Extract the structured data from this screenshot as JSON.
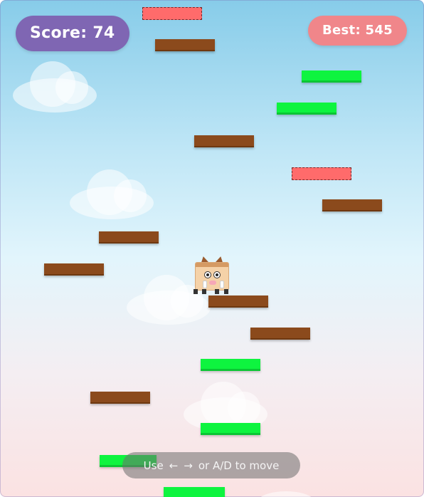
{
  "hud": {
    "score_label": "Score: 74",
    "best_label": "Best: 545"
  },
  "hint": {
    "prefix": "Use",
    "left_arrow": "←",
    "right_arrow": "→",
    "suffix": "or A/D to move"
  },
  "platform_types": [
    "normal",
    "spring",
    "breakable"
  ],
  "colors": {
    "score_pill": "#7f66b3",
    "best_pill": "#f0868a",
    "normal_platform": "#8b4a1c",
    "spring_platform": "#0ef43f",
    "breakable_platform": "#ff6b6b",
    "sky_top": "#87cce9",
    "sky_bottom": "#fbe2e2"
  },
  "player": {
    "character": "boar"
  }
}
